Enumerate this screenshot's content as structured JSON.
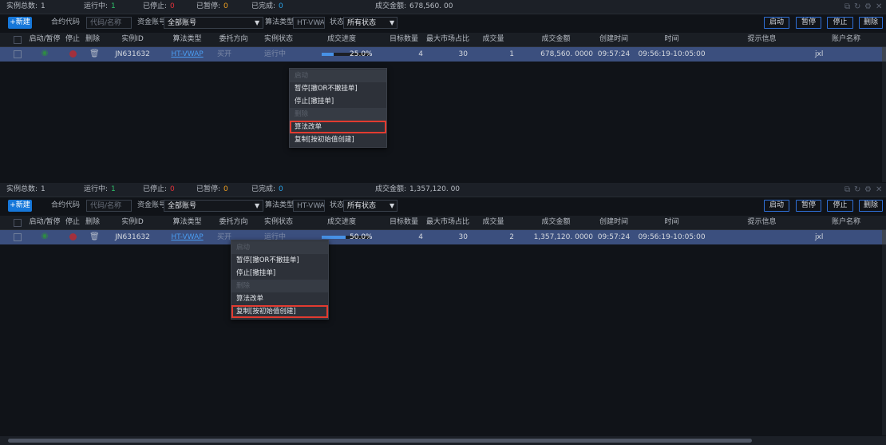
{
  "colors": {
    "accent": "#1677d9",
    "running": "#2ec26a",
    "stopped": "#e0303a",
    "paused": "#f0a020",
    "finished": "#29a3e8",
    "selected_row": "#3b4f7e",
    "highlight_box": "#e23b30"
  },
  "panels": [
    {
      "stats": {
        "total_label": "实例总数:",
        "total": "1",
        "running_label": "运行中:",
        "running": "1",
        "stopped_label": "已停止:",
        "stopped": "0",
        "paused_label": "已暂停:",
        "paused": "0",
        "finished_label": "已完成:",
        "finished": "0",
        "amount_label": "成交金额:",
        "amount": "678,560. 00"
      },
      "toolbar": {
        "new_label": "+新建",
        "contract_label": "合约代码",
        "contract_placeholder": "代码/名称",
        "account_label": "资金账号",
        "account_value": "全部账号",
        "algo_label": "算法类型",
        "algo_value": "HT-VWAP",
        "status_label": "状态",
        "status_value": "所有状态",
        "start": "启动",
        "pause": "暂停",
        "stop": "停止",
        "delete": "删除"
      },
      "columns": [
        "启动/暂停",
        "停止",
        "删除",
        "实例ID",
        "算法类型",
        "委托方向",
        "实例状态",
        "成交进度",
        "目标数量",
        "最大市场占比",
        "成交量",
        "成交金额",
        "创建时间",
        "时间",
        "提示信息",
        "账户名称"
      ],
      "row": {
        "instance_id": "JN631632",
        "algo": "HT-VWAP",
        "direction": "买开",
        "status": "运行中",
        "progress": 25.0,
        "progress_text": "25.0%",
        "target_qty": "4",
        "max_ratio": "30",
        "volume": "1",
        "amount": "678,560. 0000",
        "created": "09:57:24",
        "time": "09:56:19-10:05:00",
        "hint": "",
        "account": "jxl"
      },
      "menu": {
        "items": [
          {
            "label": "启动",
            "disabled": true
          },
          {
            "label": "暂停[撤OR不撤挂单]",
            "disabled": false
          },
          {
            "label": "停止[撤挂单]",
            "disabled": false
          },
          {
            "label": "删除",
            "disabled": true
          },
          {
            "label": "算法改单",
            "disabled": false,
            "highlight": true
          },
          {
            "label": "复制[按初始值创建]",
            "disabled": false
          }
        ]
      }
    },
    {
      "stats": {
        "total_label": "实例总数:",
        "total": "1",
        "running_label": "运行中:",
        "running": "1",
        "stopped_label": "已停止:",
        "stopped": "0",
        "paused_label": "已暂停:",
        "paused": "0",
        "finished_label": "已完成:",
        "finished": "0",
        "amount_label": "成交金额:",
        "amount": "1,357,120. 00"
      },
      "toolbar": {
        "new_label": "+新建",
        "contract_label": "合约代码",
        "contract_placeholder": "代码/名称",
        "account_label": "资金账号",
        "account_value": "全部账号",
        "algo_label": "算法类型",
        "algo_value": "HT-VWAP",
        "status_label": "状态",
        "status_value": "所有状态",
        "start": "启动",
        "pause": "暂停",
        "stop": "停止",
        "delete": "删除"
      },
      "columns": [
        "启动/暂停",
        "停止",
        "删除",
        "实例ID",
        "算法类型",
        "委托方向",
        "实例状态",
        "成交进度",
        "目标数量",
        "最大市场占比",
        "成交量",
        "成交金额",
        "创建时间",
        "时间",
        "提示信息",
        "账户名称"
      ],
      "row": {
        "instance_id": "JN631632",
        "algo": "HT-VWAP",
        "direction": "买开",
        "status": "运行中",
        "progress": 50.0,
        "progress_text": "50.0%",
        "target_qty": "4",
        "max_ratio": "30",
        "volume": "2",
        "amount": "1,357,120. 0000",
        "created": "09:57:24",
        "time": "09:56:19-10:05:00",
        "hint": "",
        "account": "jxl"
      },
      "menu": {
        "items": [
          {
            "label": "启动",
            "disabled": true
          },
          {
            "label": "暂停[撤OR不撤挂单]",
            "disabled": false
          },
          {
            "label": "停止[撤挂单]",
            "disabled": false
          },
          {
            "label": "删除",
            "disabled": true
          },
          {
            "label": "算法改单",
            "disabled": false
          },
          {
            "label": "复制[按初始值创建]",
            "disabled": false,
            "highlight": true
          }
        ]
      }
    }
  ]
}
